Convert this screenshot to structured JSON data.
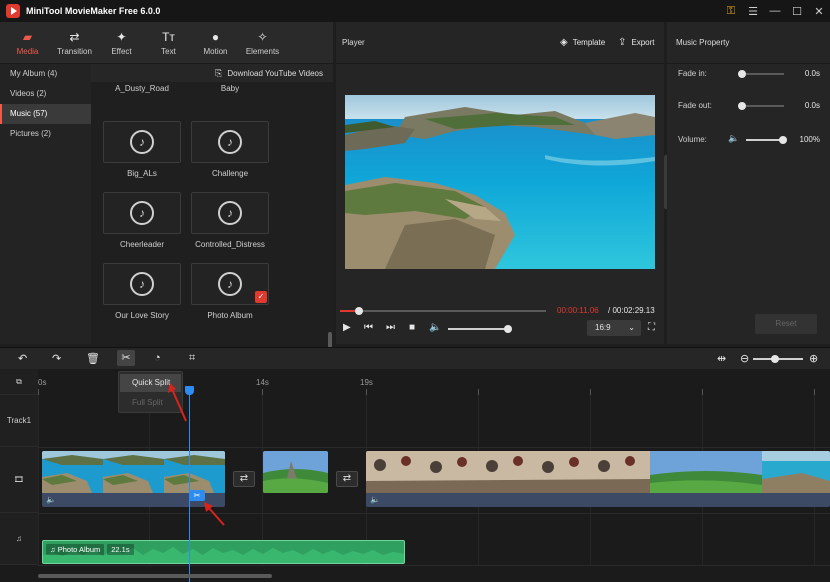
{
  "window": {
    "title": "MiniTool MovieMaker Free 6.0.0",
    "icons": [
      "key-icon",
      "menu-icon",
      "minimize-icon",
      "maximize-icon",
      "close-icon"
    ]
  },
  "tabs": [
    {
      "label": "Media",
      "icon": "media-icon",
      "glyph": "▰",
      "active": true
    },
    {
      "label": "Transition",
      "icon": "transition-icon",
      "glyph": "⇄"
    },
    {
      "label": "Effect",
      "icon": "effect-icon",
      "glyph": "✦"
    },
    {
      "label": "Text",
      "icon": "text-icon",
      "glyph": "Tт"
    },
    {
      "label": "Motion",
      "icon": "motion-icon",
      "glyph": "●"
    },
    {
      "label": "Elements",
      "icon": "elements-icon",
      "glyph": "✧"
    }
  ],
  "sidebar": {
    "items": [
      {
        "label": "My Album (4)"
      },
      {
        "label": "Videos (2)"
      },
      {
        "label": "Music (57)",
        "active": true
      },
      {
        "label": "Pictures (2)"
      }
    ]
  },
  "library": {
    "download_label": "Download YouTube Videos",
    "music": [
      {
        "name": "A_Dusty_Road"
      },
      {
        "name": "Baby"
      },
      {
        "name": "Big_ALs"
      },
      {
        "name": "Challenge"
      },
      {
        "name": "Cheerleader"
      },
      {
        "name": "Controlled_Distress"
      },
      {
        "name": "Our Love Story"
      },
      {
        "name": "Photo Album",
        "selected": true
      }
    ]
  },
  "player": {
    "title": "Player",
    "template_label": "Template",
    "export_label": "Export",
    "current_time": "00:00:11.06",
    "total_time": "/ 00:02:29.13",
    "progress_fraction": 0.09,
    "volume_fraction": 1.0,
    "aspect_ratio": "16:9"
  },
  "music_property": {
    "title": "Music Property",
    "fade_in_label": "Fade in:",
    "fade_in_value": "0.0s",
    "fade_out_label": "Fade out:",
    "fade_out_value": "0.0s",
    "volume_label": "Volume:",
    "volume_value": "100%",
    "reset_label": "Reset"
  },
  "timeline": {
    "ruler": [
      "0s",
      "14s",
      "19s"
    ],
    "track_label": "Track1",
    "split_menu": {
      "quick_split": "Quick Split",
      "full_split": "Full Split"
    },
    "audio_clip": {
      "name": "Photo Album",
      "duration": "22.1s"
    }
  },
  "colors": {
    "accent": "#f05a4a",
    "playhead": "#2e8cf0",
    "audio": "#2fa060",
    "clip_bar": "#3d4a66"
  }
}
